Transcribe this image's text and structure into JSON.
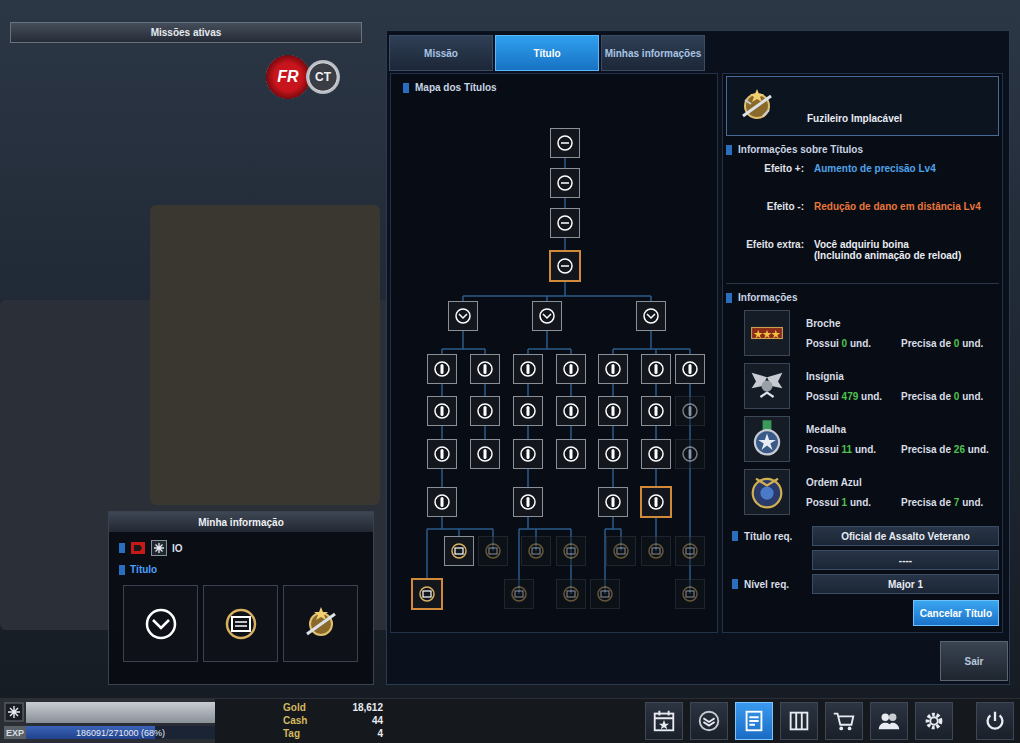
{
  "active_missions": "Missões ativas",
  "logo": {
    "left": "FR",
    "right": "CT"
  },
  "tabs": [
    {
      "label": "Missão",
      "selected": false
    },
    {
      "label": "Título",
      "selected": true
    },
    {
      "label": "Minhas informações",
      "selected": false
    }
  ],
  "title_map": {
    "heading": "Mapa dos Títulos",
    "rows": [
      [
        {
          "unlocked": true,
          "equipped": false
        },
        {
          "unlocked": true,
          "equipped": false
        },
        {
          "unlocked": true,
          "equipped": false
        },
        {
          "unlocked": true,
          "equipped": true
        }
      ],
      [
        {
          "unlocked": true,
          "equipped": false
        },
        {
          "unlocked": true,
          "equipped": false
        },
        {
          "unlocked": true,
          "equipped": false
        }
      ],
      [
        {
          "unlocked": true,
          "equipped": false
        },
        {
          "unlocked": true,
          "equipped": false
        },
        {
          "unlocked": true,
          "equipped": false
        },
        {
          "unlocked": true,
          "equipped": false
        },
        {
          "unlocked": true,
          "equipped": false
        },
        {
          "unlocked": true,
          "equipped": false
        },
        {
          "unlocked": true,
          "equipped": false
        }
      ],
      [
        {
          "unlocked": true,
          "equipped": false
        },
        {
          "unlocked": true,
          "equipped": false
        },
        {
          "unlocked": true,
          "equipped": false
        },
        {
          "unlocked": true,
          "equipped": false
        },
        {
          "unlocked": true,
          "equipped": false
        },
        {
          "unlocked": true,
          "equipped": false
        },
        {
          "unlocked": false,
          "equipped": false
        }
      ],
      [
        {
          "unlocked": true,
          "equipped": false
        },
        {
          "unlocked": true,
          "equipped": false
        },
        {
          "unlocked": true,
          "equipped": false
        },
        {
          "unlocked": true,
          "equipped": false
        },
        {
          "unlocked": true,
          "equipped": false
        },
        {
          "unlocked": true,
          "equipped": false
        },
        {
          "unlocked": false,
          "equipped": false
        }
      ],
      [
        {
          "unlocked": true,
          "equipped": false
        },
        {
          "unlocked": true,
          "equipped": false
        },
        {
          "unlocked": true,
          "equipped": false
        },
        {
          "unlocked": true,
          "equipped": true
        }
      ],
      [
        {
          "unlocked": true,
          "equipped": false
        },
        {
          "unlocked": false,
          "equipped": false
        },
        {
          "unlocked": false,
          "equipped": false
        },
        {
          "unlocked": false,
          "equipped": false
        },
        {
          "unlocked": false,
          "equipped": false
        },
        {
          "unlocked": false,
          "equipped": false
        },
        {
          "unlocked": false,
          "equipped": false
        }
      ],
      [
        {
          "unlocked": true,
          "equipped": true
        },
        {
          "unlocked": false,
          "equipped": false
        },
        {
          "unlocked": false,
          "equipped": false
        },
        {
          "unlocked": false,
          "equipped": false
        },
        {
          "unlocked": false,
          "equipped": false
        }
      ]
    ]
  },
  "title_detail": {
    "name": "Fuzileiro Implacável",
    "section": "Informações sobre Títulos",
    "effects": [
      {
        "label": "Efeito +:",
        "lines": [
          "Aumento de precisão Lv4"
        ],
        "color": "#4fa3ea"
      },
      {
        "label": "Efeito -:",
        "lines": [
          "Redução de dano em distância Lv4"
        ],
        "color": "#e8763a"
      },
      {
        "label": "Efeito extra:",
        "lines": [
          "Você adquiriu boina",
          "(Incluindo animação de reload)"
        ],
        "color": "#e8ecf2"
      }
    ],
    "info_heading": "Informações",
    "items": [
      {
        "name": "Broche",
        "have_label": "Possui",
        "have": "0",
        "have_unit": "und.",
        "need_label": "Precisa de",
        "need": "0",
        "need_unit": "und."
      },
      {
        "name": "Insígnia",
        "have_label": "Possui",
        "have": "479",
        "have_unit": "und.",
        "need_label": "Precisa de",
        "need": "0",
        "need_unit": "und."
      },
      {
        "name": "Medalha",
        "have_label": "Possui",
        "have": "11",
        "have_unit": "und.",
        "need_label": "Precisa de",
        "need": "26",
        "need_unit": "und."
      },
      {
        "name": "Ordem Azul",
        "have_label": "Possui",
        "have": "1",
        "have_unit": "und.",
        "need_label": "Precisa de",
        "need": "7",
        "need_unit": "und."
      }
    ],
    "title_req_label": "Título req.",
    "title_req": [
      "Oficial de Assalto Veterano",
      "----"
    ],
    "level_req_label": "Nível req.",
    "level_req": "Major 1",
    "cancel_button": "Cancelar Título"
  },
  "exit_button": "Sair",
  "my_info": {
    "heading": "Minha informação",
    "nickname": "IO",
    "title_label": "Título"
  },
  "status_bar": {
    "exp_label": "EXP",
    "exp_reading": "186091/271000 (68%)",
    "exp_level": 0.68,
    "currencies": [
      {
        "label": "Gold",
        "value": "18,612"
      },
      {
        "label": "Cash",
        "value": "44"
      },
      {
        "label": "Tag",
        "value": "4"
      }
    ]
  },
  "toolbar": [
    {
      "selected": false
    },
    {
      "selected": false
    },
    {
      "selected": true
    },
    {
      "selected": false
    },
    {
      "selected": false
    },
    {
      "selected": false
    },
    {
      "selected": false
    },
    {
      "selected": false
    }
  ]
}
